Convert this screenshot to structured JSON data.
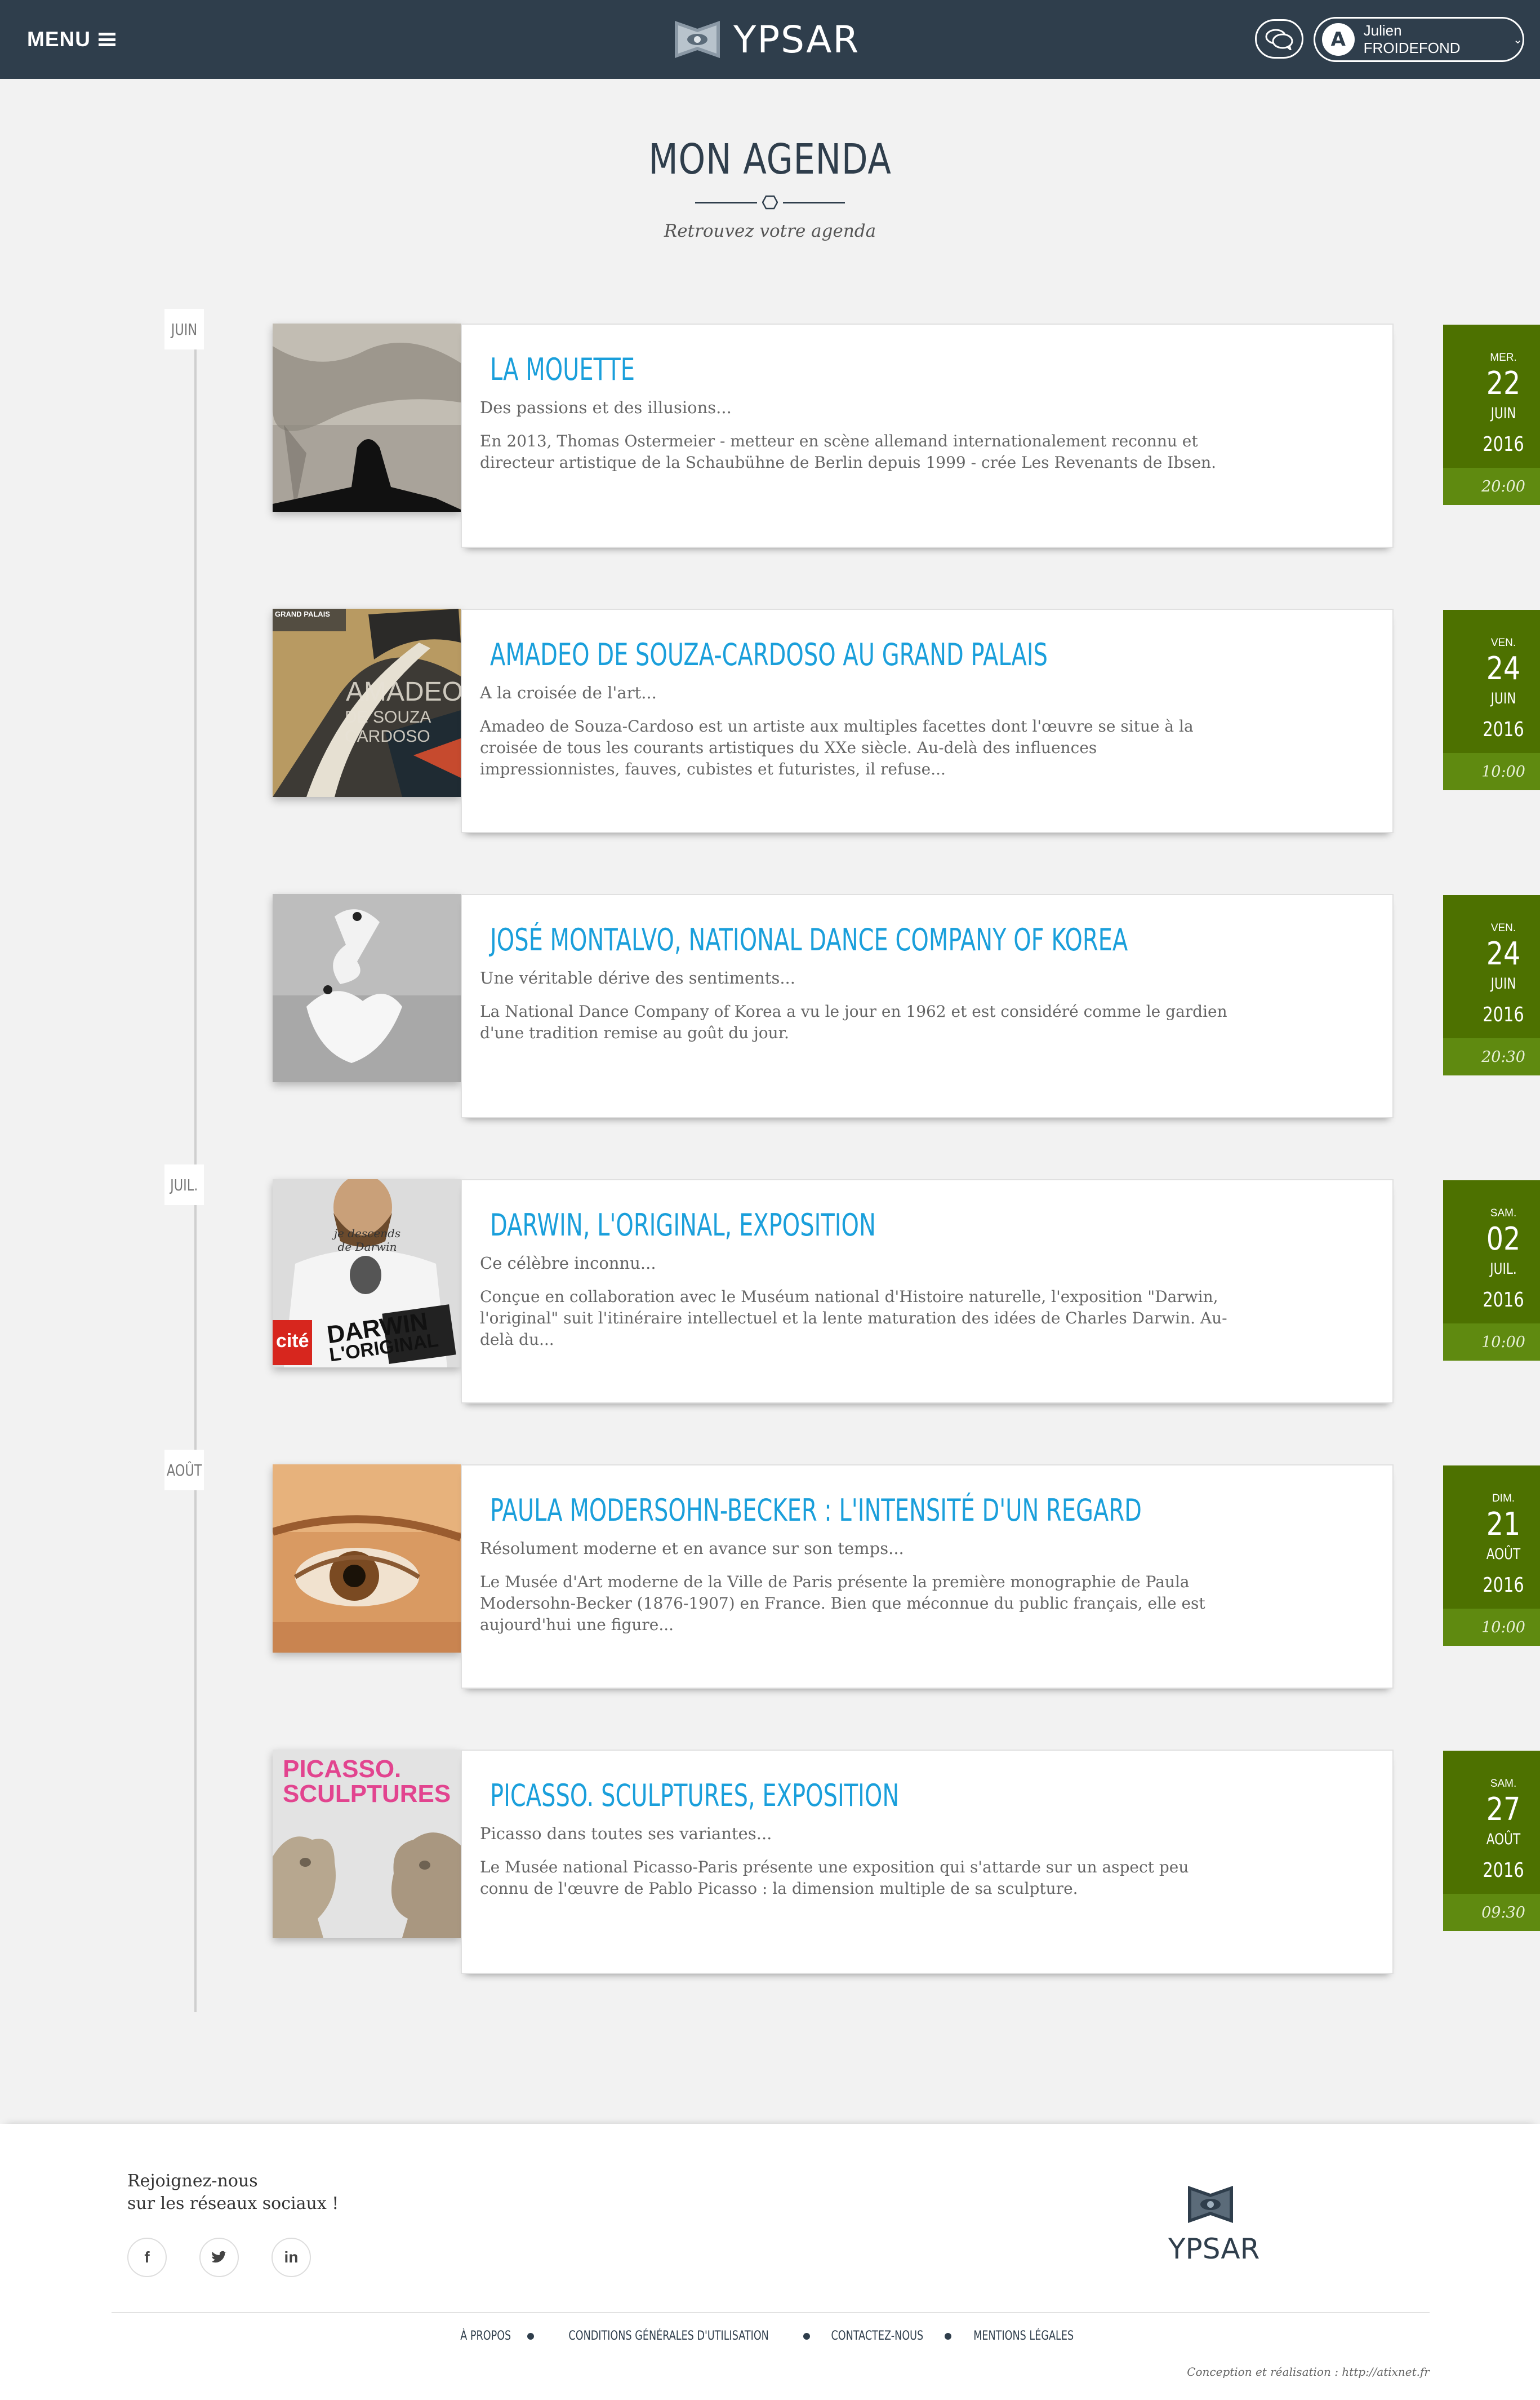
{
  "header": {
    "menu_label": "MENU",
    "brand": "YPSAR",
    "user_name": "Julien FROIDEFOND"
  },
  "page": {
    "title": "MON AGENDA",
    "subtitle": "Retrouvez votre agenda"
  },
  "months": [
    "JUIN",
    "JUIL.",
    "AOÛT"
  ],
  "events": [
    {
      "title": "LA MOUETTE",
      "lead": "Des passions et des illusions...",
      "description": "En 2013, Thomas Ostermeier - metteur en scène allemand internationalement reconnu et directeur artistique de la Schaubühne de Berlin depuis 1999 - crée Les Revenants de Ibsen.",
      "weekday": "MER.",
      "day": "22",
      "month": "JUIN",
      "year": "2016",
      "time": "20:00"
    },
    {
      "title": "AMADEO DE SOUZA-CARDOSO AU GRAND PALAIS",
      "lead": "A la croisée de l'art...",
      "description": "Amadeo de Souza-Cardoso est un artiste aux multiples facettes dont l'œuvre se situe à la croisée de tous les courants artistiques du XXe siècle. Au-delà des influences impressionnistes, fauves, cubistes et futuristes, il refuse...",
      "weekday": "VEN.",
      "day": "24",
      "month": "JUIN",
      "year": "2016",
      "time": "10:00",
      "image_text": {
        "top": "GRAND PALAIS",
        "line1": "AMADEO",
        "line2": "DE SOUZA",
        "line3": "CARDOSO"
      }
    },
    {
      "title": "JOSÉ MONTALVO, NATIONAL DANCE COMPANY OF KOREA",
      "lead": "Une véritable dérive des sentiments...",
      "description": "La National Dance Company of Korea a vu le jour en 1962 et est considéré comme le gardien d'une tradition remise au goût du jour.",
      "weekday": "VEN.",
      "day": "24",
      "month": "JUIN",
      "year": "2016",
      "time": "20:30"
    },
    {
      "title": "DARWIN, L'ORIGINAL, EXPOSITION",
      "lead": "Ce célèbre inconnu...",
      "description": "Conçue en collaboration avec le Muséum national d'Histoire naturelle, l'exposition \"Darwin, l'original\" suit l'itinéraire intellectuel et la lente maturation des idées de Charles Darwin. Au-delà du...",
      "weekday": "SAM.",
      "day": "02",
      "month": "JUIL.",
      "year": "2016",
      "time": "10:00",
      "image_text": {
        "shirt": "je descends de Darwin",
        "cite": "cité",
        "line1": "DARWIN",
        "line2": "L'ORIGINAL"
      }
    },
    {
      "title": "PAULA MODERSOHN-BECKER : L'INTENSITÉ D'UN REGARD",
      "lead": "Résolument moderne et en avance sur son temps...",
      "description": "Le Musée d'Art moderne de la Ville de Paris présente la première monographie de Paula Modersohn-Becker (1876-1907) en France. Bien que méconnue du public français, elle est aujourd'hui une figure...",
      "weekday": "DIM.",
      "day": "21",
      "month": "AOÛT",
      "year": "2016",
      "time": "10:00"
    },
    {
      "title": "PICASSO. SCULPTURES, EXPOSITION",
      "lead": "Picasso dans toutes ses variantes...",
      "description": "Le Musée national Picasso-Paris présente une exposition qui s'attarde sur un aspect peu connu de l'œuvre de Pablo Picasso : la dimension multiple de sa sculpture.",
      "weekday": "SAM.",
      "day": "27",
      "month": "AOÛT",
      "year": "2016",
      "time": "09:30",
      "image_text": {
        "line1": "PICASSO.",
        "line2": "SCULPTURES"
      }
    }
  ],
  "footer": {
    "join_line1": "Rejoignez-nous",
    "join_line2": "sur les réseaux sociaux !",
    "social": [
      "facebook-icon",
      "twitter-icon",
      "linkedin-icon"
    ],
    "brand": "YPSAR",
    "links": [
      "À PROPOS",
      "CONDITIONS GÉNÉRALES D'UTILISATION",
      "CONTACTEZ-NOUS",
      "MENTIONS LÉGALES"
    ],
    "credit": "Conception et réalisation : http://atixnet.fr"
  },
  "colors": {
    "header_bg": "#2f3e4c",
    "title_blue": "#1a9fdb",
    "date_green": "#4d7100",
    "time_green": "#5f8a10"
  }
}
